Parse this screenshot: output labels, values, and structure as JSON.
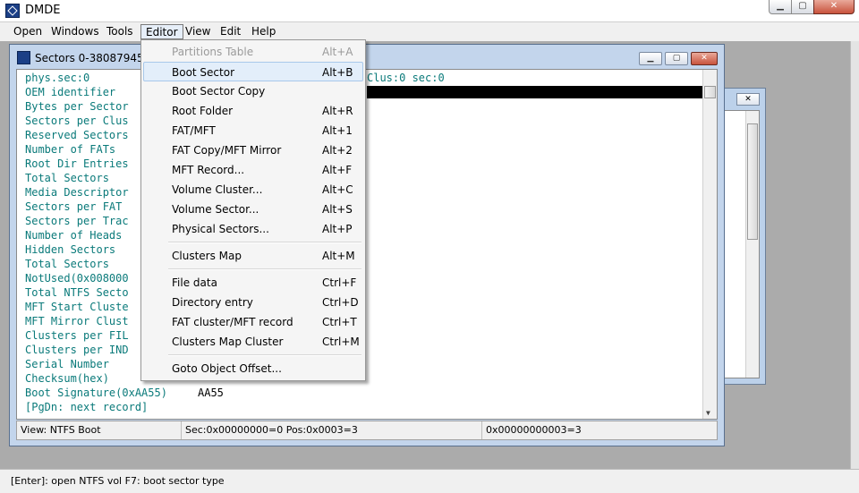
{
  "app": {
    "title": "DMDE",
    "icon": "dmde-app-icon"
  },
  "menubar": [
    {
      "id": "open",
      "label": "Open"
    },
    {
      "id": "windows",
      "label": "Windows"
    },
    {
      "id": "tools",
      "label": "Tools"
    },
    {
      "id": "editor",
      "label": "Editor"
    },
    {
      "id": "view",
      "label": "View"
    },
    {
      "id": "edit",
      "label": "Edit"
    },
    {
      "id": "help",
      "label": "Help"
    }
  ],
  "editor_menu": {
    "items": [
      {
        "label": "Partitions Table",
        "shortcut": "Alt+A",
        "disabled": true
      },
      {
        "label": "Boot Sector",
        "shortcut": "Alt+B",
        "highlighted": true
      },
      {
        "label": "Boot Sector Copy",
        "shortcut": ""
      },
      {
        "label": "Root Folder",
        "shortcut": "Alt+R"
      },
      {
        "label": "FAT/MFT",
        "shortcut": "Alt+1"
      },
      {
        "label": "FAT Copy/MFT Mirror",
        "shortcut": "Alt+2"
      },
      {
        "label": "MFT Record...",
        "shortcut": "Alt+F"
      },
      {
        "label": "Volume Cluster...",
        "shortcut": "Alt+C"
      },
      {
        "label": "Volume Sector...",
        "shortcut": "Alt+S"
      },
      {
        "label": "Physical Sectors...",
        "shortcut": "Alt+P"
      },
      {
        "label": "Clusters Map",
        "shortcut": "Alt+M"
      },
      {
        "label": "File data",
        "shortcut": "Ctrl+F"
      },
      {
        "label": "Directory entry",
        "shortcut": "Ctrl+D"
      },
      {
        "label": "FAT cluster/MFT record",
        "shortcut": "Ctrl+T"
      },
      {
        "label": "Clusters Map Cluster",
        "shortcut": "Ctrl+M"
      },
      {
        "label": "Goto Object Offset...",
        "shortcut": ""
      }
    ]
  },
  "sectors_window": {
    "title": "Sectors 0-380879451",
    "fields": [
      "phys.sec:0",
      "OEM identifier",
      "Bytes per Sector",
      "Sectors per Clus",
      "Reserved Sectors",
      "Number of FATs",
      "Root Dir Entries",
      "Total Sectors",
      "Media Descriptor",
      "Sectors per FAT",
      "Sectors per Trac",
      "Number of Heads",
      "Hidden Sectors",
      "Total Sectors",
      "NotUsed(0x008000",
      "Total NTFS Secto",
      "MFT Start Cluste",
      "MFT Mirror Clust",
      "Clusters per FIL",
      "Clusters per IND",
      "Serial Number",
      "Checksum(hex)",
      "Boot Signature(0xAA55)",
      "[PgDn: next record]"
    ],
    "clus_info": "Clus:0 sec:0",
    "boot_signature_value": "AA55",
    "status": {
      "view": "View: NTFS Boot",
      "position": "Sec:0x00000000=0 Pos:0x0003=3",
      "value": "0x00000000003=3"
    }
  },
  "bottom_status": "[Enter]: open NTFS vol   F7: boot sector type"
}
